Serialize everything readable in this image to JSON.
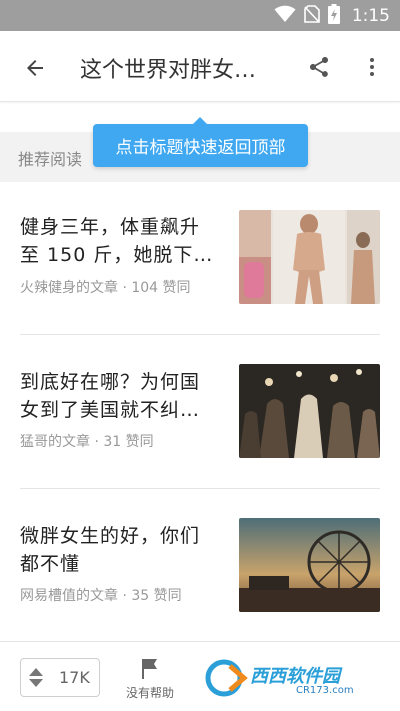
{
  "status_bar": {
    "time": "1:15"
  },
  "app_bar": {
    "title": "这个世界对胖女…"
  },
  "section": {
    "label": "推荐阅读"
  },
  "tooltip": {
    "text": "点击标题快速返回顶部"
  },
  "articles": [
    {
      "title": "健身三年，体重飙升至 150 斤，她脱下…",
      "meta": "火辣健身的文章 · 104 赞同"
    },
    {
      "title": "到底好在哪？为何国女到了美国就不纠…",
      "meta": "猛哥的文章 · 31 赞同"
    },
    {
      "title": "微胖女生的好，你们都不懂",
      "meta": "网易槽值的文章 · 35 赞同"
    }
  ],
  "bottom_bar": {
    "vote_count": "17K",
    "no_help_label": "没有帮助"
  },
  "watermark": {
    "brand": "西西软件园",
    "url": "CR173.com"
  },
  "colors": {
    "accent": "#3fa8f1",
    "statusbar": "#9e9e9e",
    "section_bg": "#f2f2f2"
  }
}
